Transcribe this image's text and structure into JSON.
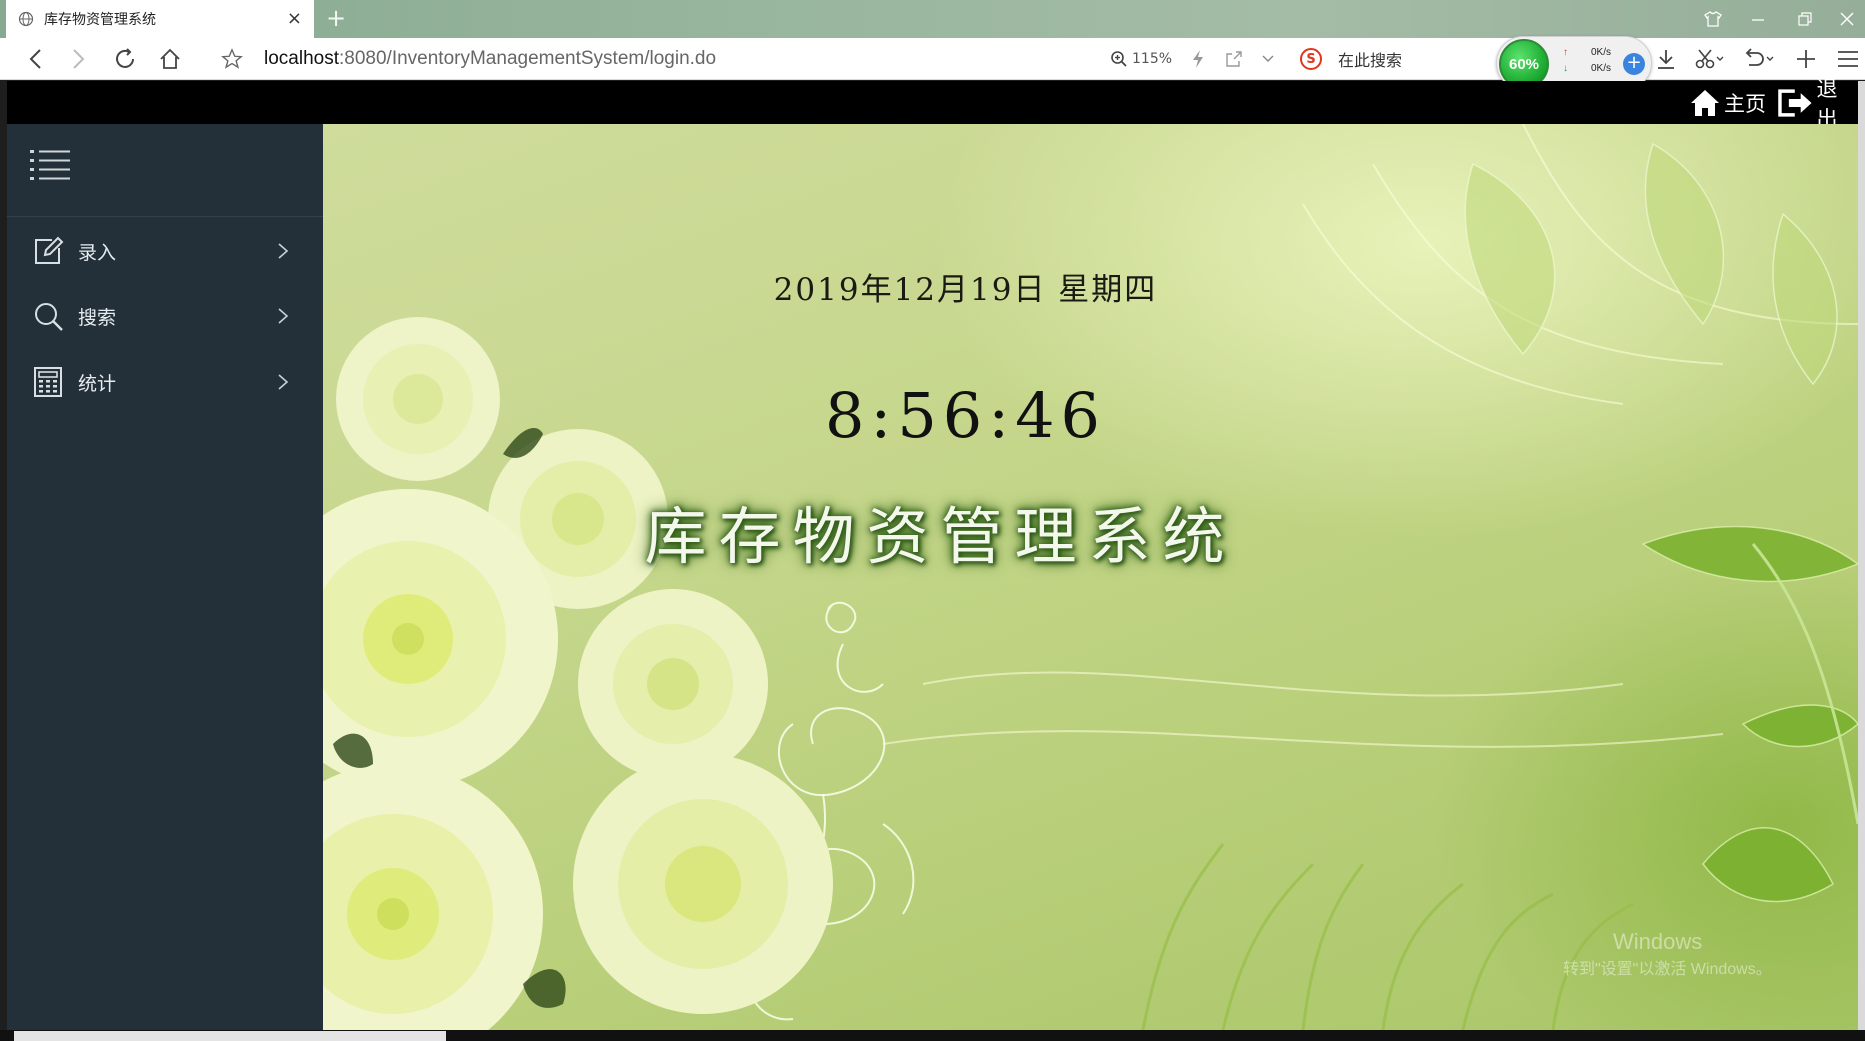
{
  "browser": {
    "tab_title": "库存物资管理系统",
    "tab_close": "×",
    "new_tab": "+",
    "url_host": "localhost",
    "url_rest": ":8080/InventoryManagementSystem/login.do",
    "zoom": "115%",
    "search_placeholder": "在此搜索",
    "search_engine_badge": "S",
    "cpu_usage": "60%",
    "net_up": "0K/s",
    "net_down": "0K/s",
    "icons": [
      "back-icon",
      "forward-icon",
      "reload-icon",
      "home-icon",
      "star-icon",
      "zoom-icon",
      "lightning-icon",
      "share-icon",
      "chevron-down-icon",
      "download-icon",
      "scissors-icon",
      "undo-icon",
      "plus-icon",
      "menu-icon",
      "shirt-icon",
      "minimize-icon",
      "restore-icon",
      "close-icon"
    ]
  },
  "header": {
    "home_label": "主页",
    "logout_label": "退出"
  },
  "sidebar": {
    "items": [
      {
        "label": "录入",
        "icon": "edit-icon"
      },
      {
        "label": "搜索",
        "icon": "search-icon"
      },
      {
        "label": "统计",
        "icon": "calculator-icon"
      }
    ]
  },
  "main": {
    "date": "2019年12月19日 星期四",
    "time": "8:56:46",
    "title": "库存物资管理系统"
  },
  "watermark": {
    "line1": "Windows",
    "line2": "转到\"设置\"以激活 Windows。"
  },
  "colors": {
    "sidebar_bg": "#243039",
    "topbar_bg": "#000000",
    "title_glow": "#2f5e18",
    "content_bg": "#c6d78d"
  }
}
